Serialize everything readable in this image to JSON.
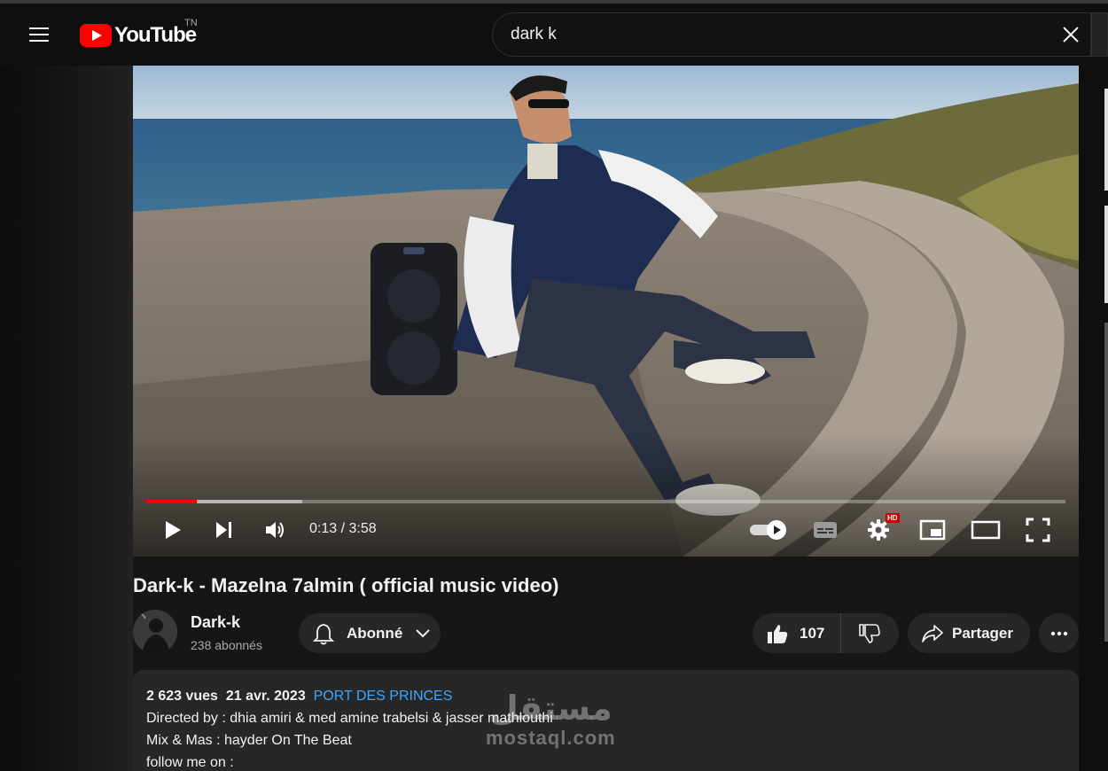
{
  "header": {
    "logo_text": "YouTube",
    "country_code": "TN",
    "search_value": "dark k"
  },
  "player": {
    "current_time": "0:13",
    "duration": "3:58",
    "time_display": "0:13 / 3:58",
    "played_fraction": 0.055,
    "buffered_fraction": 0.17,
    "hd_badge": "HD"
  },
  "video": {
    "title": "Dark-k - Mazelna 7almin ( official music video)"
  },
  "channel": {
    "name": "Dark-k",
    "subscribers": "238 abonnés",
    "subscribe_label": "Abonné"
  },
  "actions": {
    "like_count": "107",
    "share_label": "Partager"
  },
  "description": {
    "views": "2 623 vues",
    "date": "21 avr. 2023",
    "location": "PORT DES PRINCES",
    "lines": [
      "Directed by : dhia amiri & med amine trabelsi & jasser mathlouthi",
      "Mix & Mas : hayder On The Beat",
      "follow me on :"
    ]
  },
  "watermark": {
    "arabic": "مستقل",
    "latin": "mostaql.com"
  },
  "colors": {
    "accent_red": "#ff0000",
    "link_blue": "#3ea6ff",
    "pill_bg": "#272727"
  }
}
